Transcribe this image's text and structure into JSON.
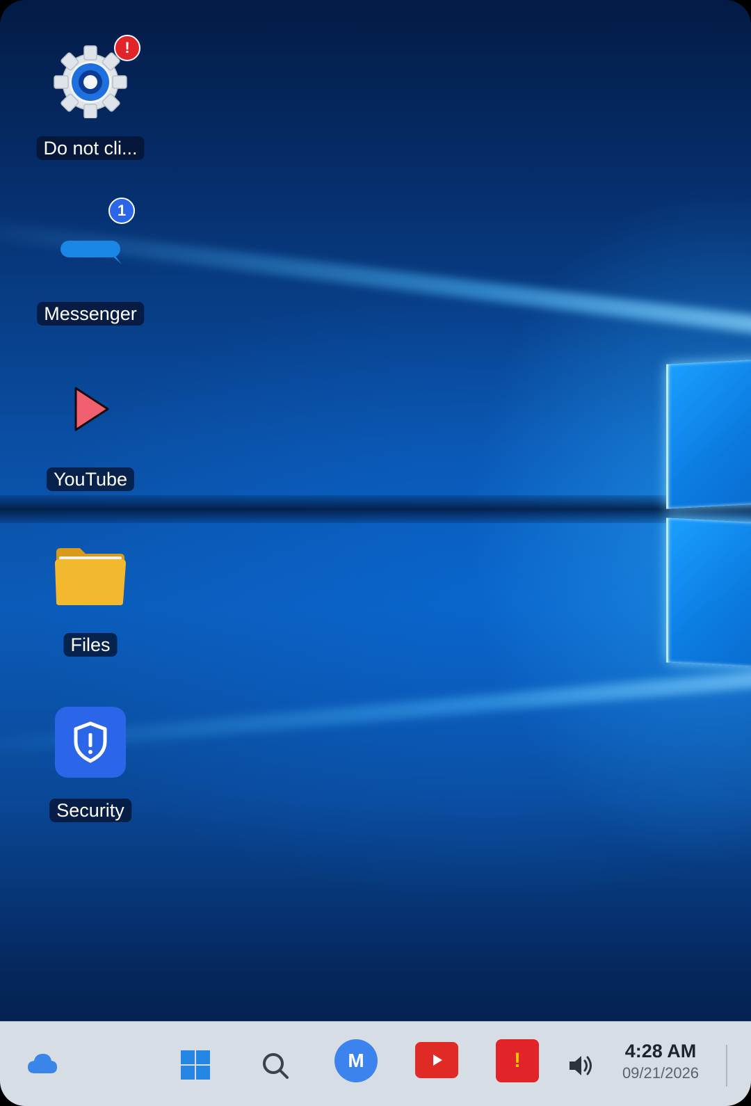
{
  "desktop": {
    "icons": [
      {
        "label": "Do not cli...",
        "icon": "gear-icon",
        "badge": "!"
      },
      {
        "label": "Messenger",
        "icon": "chat-bubble-icon",
        "badge": "1"
      },
      {
        "label": "YouTube",
        "icon": "play-icon"
      },
      {
        "label": "Files",
        "icon": "folder-icon"
      },
      {
        "label": "Security",
        "icon": "shield-icon"
      }
    ]
  },
  "taskbar": {
    "items": [
      {
        "icon": "cloud-icon"
      },
      {
        "icon": "windows-start-icon"
      },
      {
        "icon": "search-icon"
      },
      {
        "icon": "messenger-avatar",
        "text": "M"
      },
      {
        "icon": "youtube-icon"
      },
      {
        "icon": "alert-app-icon",
        "text": "!"
      },
      {
        "icon": "volume-icon"
      }
    ],
    "clock": {
      "time": "4:28 AM",
      "date": "09/21/2026"
    }
  },
  "colors": {
    "accent_blue": "#2b66e8",
    "alert_red": "#e0242a",
    "youtube_red": "#e02a26",
    "folder_yellow": "#f0b52c"
  }
}
